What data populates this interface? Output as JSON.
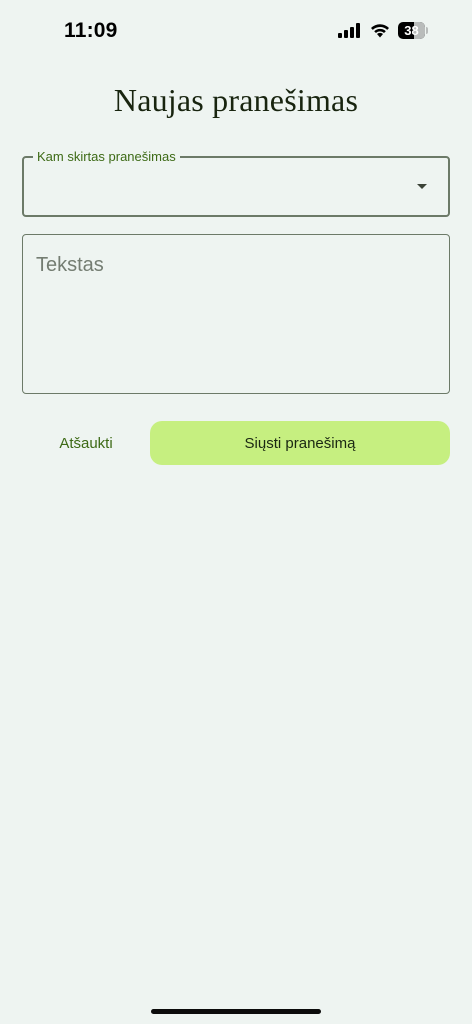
{
  "status_bar": {
    "time": "11:09",
    "battery_level": "38",
    "icons": [
      "signal-icon",
      "wifi-icon",
      "battery-icon"
    ]
  },
  "page": {
    "title": "Naujas pranešimas"
  },
  "form": {
    "recipient": {
      "label": "Kam skirtas pranešimas",
      "value": ""
    },
    "message": {
      "placeholder": "Tekstas",
      "value": ""
    }
  },
  "actions": {
    "cancel_label": "Atšaukti",
    "send_label": "Siųsti pranešimą"
  },
  "colors": {
    "background": "#eef4f1",
    "accent_green": "#c6ef80",
    "label_green": "#3d6a16",
    "border": "#6c7a68"
  }
}
